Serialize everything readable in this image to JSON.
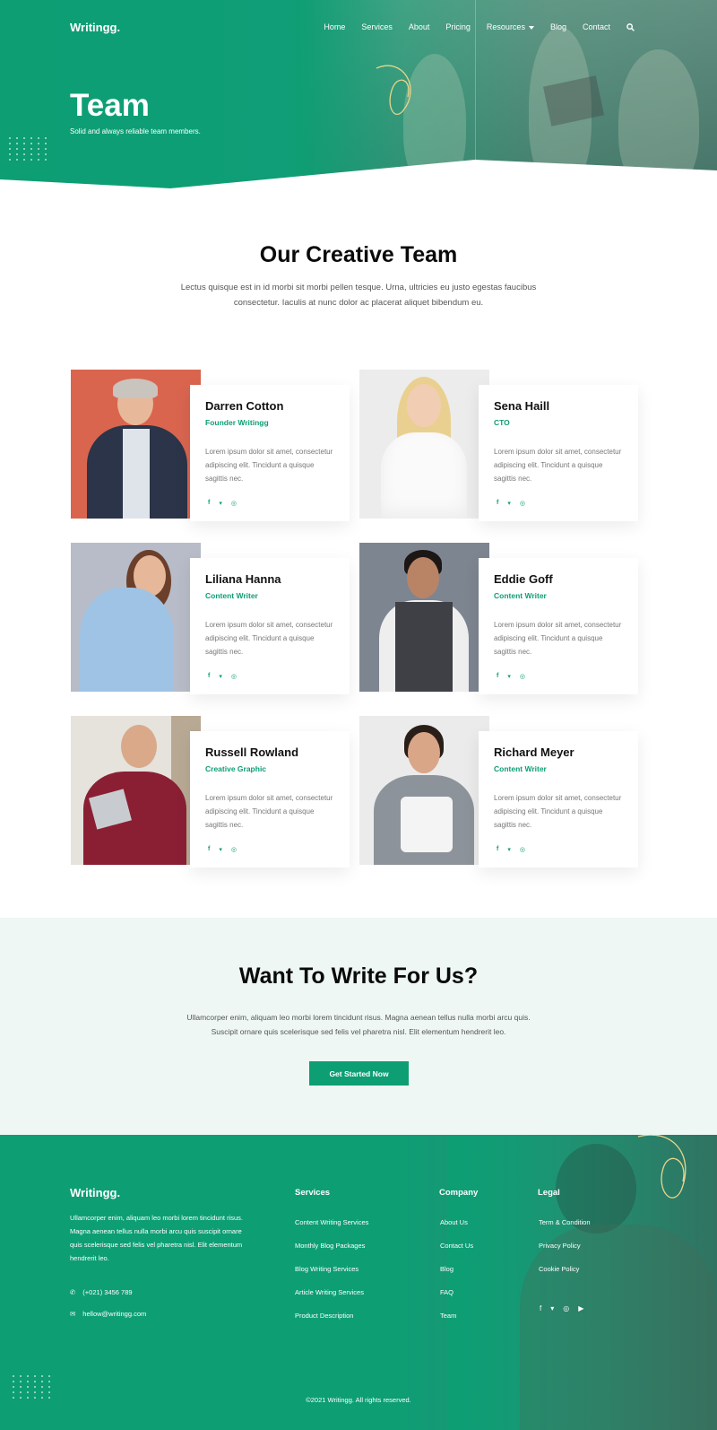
{
  "nav": {
    "logo": "Writingg.",
    "links": [
      "Home",
      "Services",
      "About",
      "Pricing",
      "Resources",
      "Blog",
      "Contact"
    ]
  },
  "hero": {
    "title": "Team",
    "subtitle": "Solid and always reliable team members."
  },
  "intro": {
    "title": "Our Creative Team",
    "text_line1": "Lectus quisque est in id morbi sit morbi pellen tesque. Urna, ultricies eu justo egestas faucibus",
    "text_line2": "consectetur. Iaculis at nunc dolor ac placerat aliquet bibendum eu."
  },
  "team": [
    {
      "name": "Darren Cotton",
      "role": "Founder Writingg",
      "desc": "Lorem ipsum dolor sit amet, consectetur adipiscing elit. Tincidunt a quisque sagittis nec."
    },
    {
      "name": "Sena Haill",
      "role": "CTO",
      "desc": "Lorem ipsum dolor sit amet, consectetur adipiscing elit. Tincidunt a quisque sagittis nec."
    },
    {
      "name": "Liliana Hanna",
      "role": "Content Writer",
      "desc": "Lorem ipsum dolor sit amet, consectetur adipiscing elit. Tincidunt a quisque sagittis nec."
    },
    {
      "name": "Eddie Goff",
      "role": "Content Writer",
      "desc": "Lorem ipsum dolor sit amet, consectetur adipiscing elit. Tincidunt a quisque sagittis nec."
    },
    {
      "name": "Russell Rowland",
      "role": "Creative Graphic",
      "desc": "Lorem ipsum dolor sit amet, consectetur adipiscing elit. Tincidunt a quisque sagittis nec."
    },
    {
      "name": "Richard Meyer",
      "role": "Content Writer",
      "desc": "Lorem ipsum dolor sit amet, consectetur adipiscing elit. Tincidunt a quisque sagittis nec."
    }
  ],
  "cta": {
    "title": "Want To Write For Us?",
    "text_line1": "Ullamcorper enim, aliquam leo morbi lorem tincidunt risus. Magna aenean tellus nulla morbi arcu quis.",
    "text_line2": "Suscipit ornare quis scelerisque sed felis vel pharetra nisl. Elit elementum hendrerit leo.",
    "button": "Get Started Now"
  },
  "footer": {
    "logo": "Writingg.",
    "about": "Ullamcorper enim, aliquam leo morbi lorem tincidunt risus. Magna aenean tellus nulla morbi arcu quis suscipit ornare quis scelerisque sed felis vel pharetra nisl. Elit elementum hendrerit leo.",
    "phone": "(+021) 3456 789",
    "email": "hellow@writingg.com",
    "services_title": "Services",
    "services": [
      "Content Writing Services",
      "Monthly Blog Packages",
      "Blog Writing Services",
      "Article Writing Services",
      "Product Description"
    ],
    "company_title": "Company",
    "company": [
      "About Us",
      "Contact Us",
      "Blog",
      "FAQ",
      "Team"
    ],
    "legal_title": "Legal",
    "legal": [
      "Term & Condition",
      "Privacy Policy",
      "Cookie Policy"
    ],
    "copyright": "©2021 Writingg. All rights reserved."
  },
  "colors": {
    "accent": "#0d9e74",
    "cta_bg": "#eef7f3"
  }
}
